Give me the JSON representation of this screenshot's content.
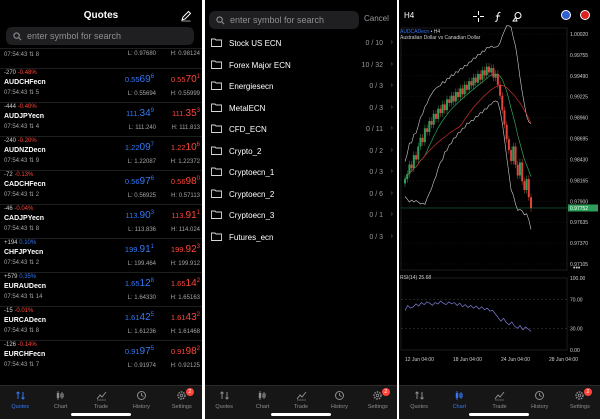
{
  "quotes": {
    "title": "Quotes",
    "search_placeholder": "enter symbol for search",
    "rows": [
      {
        "time": "07:54:43",
        "spread": "8",
        "bid_pre": "",
        "bid_big": "",
        "bid_sup": "",
        "ask_pre": "",
        "ask_big": "",
        "ask_sup": "",
        "low": "L: 0.97680",
        "high": "H: 0.98124"
      },
      {
        "change": "-270",
        "pct": "-0.48%",
        "pos": false,
        "symbol": "AUDCHFecn",
        "time": "07:54:43",
        "spread": "5",
        "bid_pre": "0.55",
        "bid_big": "69",
        "bid_sup": "6",
        "ask_pre": "0.55",
        "ask_big": "70",
        "ask_sup": "1",
        "low": "L: 0.55694",
        "high": "H: 0.55999"
      },
      {
        "change": "-444",
        "pct": "-0.40%",
        "pos": false,
        "symbol": "AUDJPYecn",
        "time": "07:54:43",
        "spread": "4",
        "bid_pre": "111.",
        "bid_big": "34",
        "bid_sup": "9",
        "ask_pre": "111.",
        "ask_big": "35",
        "ask_sup": "3",
        "low": "L: 111.240",
        "high": "H: 111.813"
      },
      {
        "change": "-240",
        "pct": "-0.20%",
        "pos": false,
        "symbol": "AUDNZDecn",
        "time": "07:54:43",
        "spread": "9",
        "bid_pre": "1.22",
        "bid_big": "09",
        "bid_sup": "7",
        "ask_pre": "1.22",
        "ask_big": "10",
        "ask_sup": "6",
        "low": "L: 1.22087",
        "high": "H: 1.22372"
      },
      {
        "change": "-72",
        "pct": "-0.13%",
        "pos": false,
        "symbol": "CADCHFecn",
        "time": "07:54:43",
        "spread": "2",
        "bid_pre": "0.56",
        "bid_big": "97",
        "bid_sup": "6",
        "ask_pre": "0.56",
        "ask_big": "98",
        "ask_sup": "0",
        "low": "L: 0.56925",
        "high": "H: 0.57113"
      },
      {
        "change": "-46",
        "pct": "-0.04%",
        "pos": false,
        "symbol": "CADJPYecn",
        "time": "07:54:43",
        "spread": "8",
        "bid_pre": "113.",
        "bid_big": "90",
        "bid_sup": "3",
        "ask_pre": "113.",
        "ask_big": "91",
        "ask_sup": "1",
        "low": "L: 113.836",
        "high": "H: 114.024"
      },
      {
        "change": "+194",
        "pct": "0.10%",
        "pos": true,
        "symbol": "CHFJPYecn",
        "time": "07:54:43",
        "spread": "2",
        "bid_pre": "199.",
        "bid_big": "91",
        "bid_sup": "1",
        "ask_pre": "199.",
        "ask_big": "92",
        "ask_sup": "3",
        "low": "L: 199.464",
        "high": "H: 199.912"
      },
      {
        "change": "+579",
        "pct": "0.35%",
        "pos": true,
        "symbol": "EURAUDecn",
        "time": "07:54:43",
        "spread": "14",
        "bid_pre": "1.65",
        "bid_big": "12",
        "bid_sup": "8",
        "ask_pre": "1.65",
        "ask_big": "14",
        "ask_sup": "2",
        "low": "L: 1.64330",
        "high": "H: 1.65163"
      },
      {
        "change": "-15",
        "pct": "-0.01%",
        "pos": false,
        "symbol": "EURCADecn",
        "time": "07:54:43",
        "spread": "8",
        "bid_pre": "1.61",
        "bid_big": "42",
        "bid_sup": "5",
        "ask_pre": "1.61",
        "ask_big": "43",
        "ask_sup": "2",
        "low": "L: 1.61236",
        "high": "H: 1.61468"
      },
      {
        "change": "-126",
        "pct": "-0.14%",
        "pos": false,
        "symbol": "EURCHFecn",
        "time": "07:54:43",
        "spread": "7",
        "bid_pre": "0.91",
        "bid_big": "97",
        "bid_sup": "5",
        "ask_pre": "0.91",
        "ask_big": "98",
        "ask_sup": "2",
        "low": "L: 0.91974",
        "high": "H: 0.92125"
      }
    ]
  },
  "tabs": [
    {
      "label": "Quotes",
      "icon": "quotes-icon"
    },
    {
      "label": "Chart",
      "icon": "chart-icon"
    },
    {
      "label": "Trade",
      "icon": "trade-icon"
    },
    {
      "label": "History",
      "icon": "history-icon"
    },
    {
      "label": "Settings",
      "icon": "settings-icon",
      "badge": "2"
    }
  ],
  "symbols": {
    "search_placeholder": "enter symbol for search",
    "cancel_label": "Cancel",
    "folders": [
      {
        "name": "Stock US ECN",
        "count": "0 / 10"
      },
      {
        "name": "Forex Major ECN",
        "count": "10 / 32"
      },
      {
        "name": "Energiesecn",
        "count": "0 / 3"
      },
      {
        "name": "MetalECN",
        "count": "0 / 3"
      },
      {
        "name": "CFD_ECN",
        "count": "0 / 11"
      },
      {
        "name": "Crypto_2",
        "count": "0 / 2"
      },
      {
        "name": "Cryptoecn_1",
        "count": "0 / 3"
      },
      {
        "name": "Cryptoecn_2",
        "count": "0 / 6"
      },
      {
        "name": "Cryptoecn_3",
        "count": "0 / 1"
      },
      {
        "name": "Futures_ecn",
        "count": "0 / 3"
      }
    ]
  },
  "chart": {
    "timeframe": "H4",
    "symbol": "AUDCADecn",
    "symbol_suffix": " • H4",
    "description": "Australian Dollar vs Canadian Dollar",
    "indicator_label": "RSI(14) 25.68",
    "price_labels": [
      "1.00020",
      "0.99755",
      "0.99490",
      "0.99225",
      "0.98960",
      "0.98695",
      "0.98430",
      "0.98165",
      "0.97900",
      "0.97635",
      "0.97370",
      "0.97105"
    ],
    "current_price": "0.97752",
    "rsi_labels": [
      "100.00",
      "70.00",
      "30.00",
      "0.00"
    ],
    "time_labels": [
      "12 Jun 04:00",
      "18 Jun 04:00",
      "24 Jun 04:00",
      "28 Jun 04:00"
    ],
    "colors": {
      "bull": "#2e9f5b",
      "bear": "#e0443a",
      "ma": "#c9302c",
      "band": "#2ea35f",
      "accent": "#3478f6"
    },
    "chart_data": {
      "type": "line",
      "title": "",
      "close": [
        0.9815,
        0.9822,
        0.9835,
        0.983,
        0.9848,
        0.9842,
        0.986,
        0.9872,
        0.9866,
        0.9885,
        0.988,
        0.9895,
        0.989,
        0.9905,
        0.9898,
        0.9912,
        0.9906,
        0.9918,
        0.991,
        0.9925,
        0.992,
        0.993,
        0.9922,
        0.9935,
        0.9928,
        0.994,
        0.9932,
        0.9945,
        0.9938,
        0.995,
        0.9944,
        0.9955,
        0.9948,
        0.996,
        0.9952,
        0.9965,
        0.9958,
        0.997,
        0.9962,
        0.9968,
        0.9955,
        0.996,
        0.9945,
        0.993,
        0.991,
        0.989,
        0.987,
        0.9855,
        0.984,
        0.986,
        0.9835,
        0.982,
        0.9838,
        0.9812,
        0.98,
        0.9815,
        0.979,
        0.9775
      ],
      "rsi": [
        55,
        62,
        58,
        60,
        64,
        61,
        66,
        63,
        67,
        65,
        62,
        66,
        64,
        68,
        65,
        63,
        67,
        64,
        66,
        62,
        65,
        60,
        63,
        59,
        62,
        58,
        61,
        57,
        60,
        56,
        58,
        54,
        55,
        50,
        45,
        40,
        44,
        38,
        35,
        39,
        33,
        30,
        34,
        28,
        32,
        29,
        26
      ],
      "ylim": [
        0.9698,
        1.0015
      ],
      "rsi_ylim": [
        0,
        100
      ]
    }
  }
}
